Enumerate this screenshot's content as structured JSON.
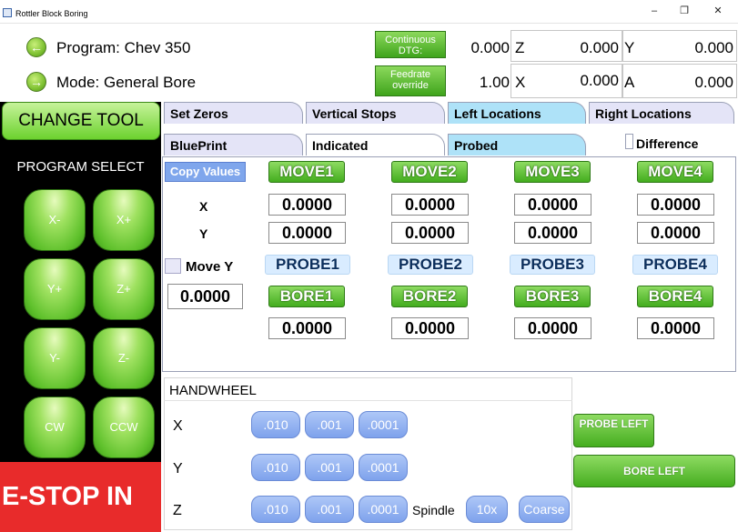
{
  "window": {
    "title": "Rottler Block Boring",
    "controls": [
      "–",
      "❐",
      "✕"
    ]
  },
  "header": {
    "program": "Program: Chev 350",
    "mode": "Mode: General Bore",
    "continuous_label": "Continuous DTG:",
    "feedrate_label": "Feedrate override",
    "dtg_value": "0.000",
    "feedrate_value": "1.00",
    "axes": [
      {
        "label": "Z",
        "value": "0.000"
      },
      {
        "label": "Y",
        "value": "0.000"
      },
      {
        "label": "X",
        "value": "0.000"
      },
      {
        "label": "A",
        "value": "0.000"
      }
    ]
  },
  "left": {
    "change_tool": "CHANGE TOOL",
    "program_select": "PROGRAM SELECT",
    "jog": [
      "X-",
      "X+",
      "Y+",
      "Z+",
      "Y-",
      "Z-",
      "CW",
      "CCW"
    ],
    "estop": "E-STOP IN"
  },
  "tabs_top": [
    "Set Zeros",
    "Vertical Stops",
    "Left Locations",
    "Right Locations"
  ],
  "tabs_sub": [
    "BluePrint",
    "Indicated",
    "Probed"
  ],
  "difference_label": "Difference",
  "panel": {
    "copy_values": "Copy Values",
    "x_label": "X",
    "y_label": "Y",
    "move_y_label": "Move Y",
    "move_y_value": "0.0000",
    "moves": [
      "MOVE1",
      "MOVE2",
      "MOVE3",
      "MOVE4"
    ],
    "probes": [
      "PROBE1",
      "PROBE2",
      "PROBE3",
      "PROBE4"
    ],
    "bores": [
      "BORE1",
      "BORE2",
      "BORE3",
      "BORE4"
    ],
    "x_values": [
      "0.0000",
      "0.0000",
      "0.0000",
      "0.0000"
    ],
    "y_values": [
      "0.0000",
      "0.0000",
      "0.0000",
      "0.0000"
    ],
    "bore_values": [
      "0.0000",
      "0.0000",
      "0.0000",
      "0.0000"
    ]
  },
  "handwheel": {
    "title": "HANDWHEEL",
    "axes": [
      "X",
      "Y",
      "Z"
    ],
    "increments": [
      ".010",
      ".001",
      ".0001"
    ],
    "spindle_label": "Spindle",
    "spindle_buttons": [
      "10x",
      "Coarse"
    ]
  },
  "probe_left": "PROBE LEFT",
  "bore_left": "BORE LEFT"
}
